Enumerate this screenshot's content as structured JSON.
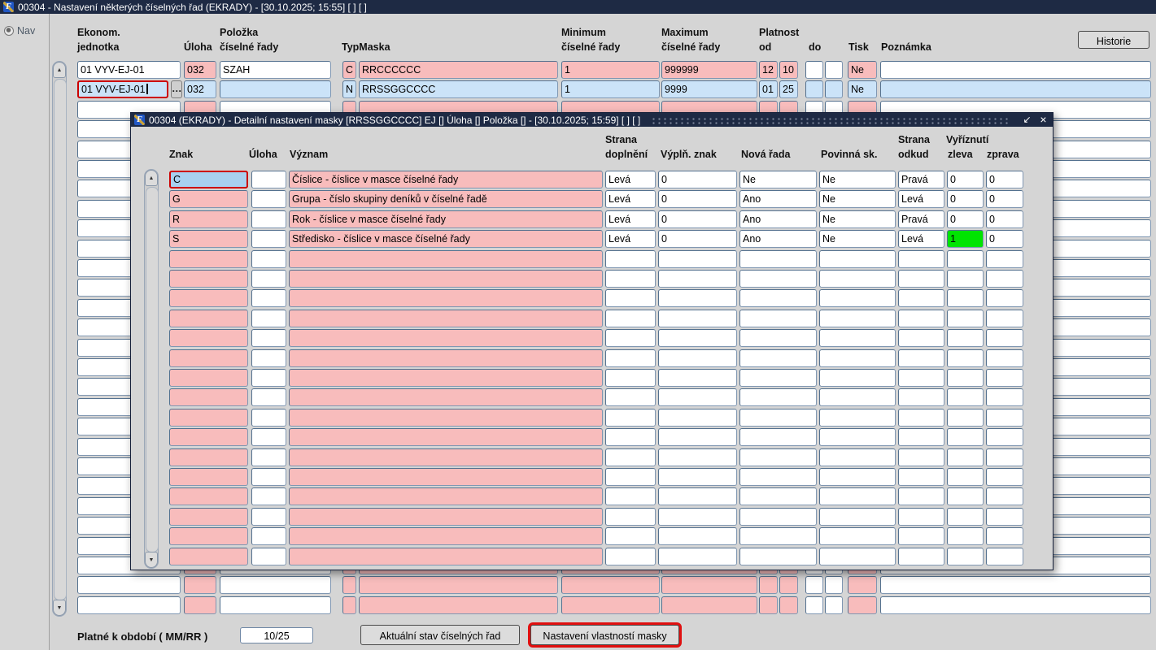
{
  "colors": {
    "titlebar": "#1e2a44",
    "pink": "#f8bcbc",
    "rowblue": "#cbe3f8",
    "selblue": "#a8d0f0",
    "green": "#00e400",
    "focusred": "#cc0000"
  },
  "window": {
    "title": "00304 - Nastavení některých číselných řad (EKRADY) - [30.10.2025; 15:55]  [ ]  [ ]",
    "icon_letter": "F"
  },
  "sidebar": {
    "nav": "Nav"
  },
  "toolbar": {
    "historie": "Historie"
  },
  "main_table": {
    "headers": {
      "ekonom": [
        "Ekonom.",
        "jednotka"
      ],
      "uloha": "Úloha",
      "polozka": [
        "Položka",
        "číselné řady"
      ],
      "typ_maska": "TypMaska",
      "minimum": [
        "Minimum",
        "číselné řady"
      ],
      "maximum": [
        "Maximum",
        "číselné řady"
      ],
      "platnost": [
        "Platnost",
        "od"
      ],
      "do": "do",
      "tisk": "Tisk",
      "poznamka": "Poznámka"
    },
    "rows": [
      {
        "variant": "normal",
        "ekonom": "01 VYV-EJ-01",
        "uloha": "032",
        "polozka": "SZAH",
        "typ": "C",
        "maska": "RRCCCCCC",
        "min": "1",
        "max": "999999",
        "od1": "12",
        "od2": "10",
        "do1": "",
        "do2": "",
        "tisk": "Ne",
        "poznamka": ""
      },
      {
        "variant": "selected",
        "ekonom": "01 VYV-EJ-01",
        "uloha": "032",
        "polozka": "",
        "typ": "N",
        "maska": "RRSSGGCCCC",
        "min": "1",
        "max": "9999",
        "od1": "01",
        "od2": "25",
        "do1": "",
        "do2": "",
        "tisk": "Ne",
        "poznamka": ""
      }
    ],
    "empty_rows": 26
  },
  "footer": {
    "label": "Platné k období ( MM/RR )",
    "value": "10/25",
    "btn_stav": "Aktuální stav číselných řad",
    "btn_maska": "Nastavení vlastností masky"
  },
  "modal": {
    "title": "00304 (EKRADY) - Detailní nastavení masky [RRSSGGCCCC] EJ [] Úloha [] Položka [] - [30.10.2025; 15:59]  [ ]  [ ]",
    "icon_letter": "F",
    "headers": {
      "znak": "Znak",
      "uloha": "Úloha",
      "vyznam": "Význam",
      "strana_doplneni": [
        "Strana",
        "doplnění"
      ],
      "vypln_znak": "Výplň. znak",
      "nova_rada": "Nová řada",
      "povinna_sk": "Povinná sk.",
      "strana_odkud": [
        "Strana",
        "odkud"
      ],
      "vyriznuti": "Vyříznutí",
      "zleva": "zleva",
      "zprava": "zprava"
    },
    "rows": [
      {
        "znak": "C",
        "uloha": "",
        "vyznam": "Číslice - číslice v masce číselné řady",
        "strana_doplneni": "Levá",
        "vypln_znak": "0",
        "nova_rada": "Ne",
        "povinna_sk": "Ne",
        "strana_odkud": "Pravá",
        "zleva": "0",
        "zprava": "0",
        "znak_selected": true
      },
      {
        "znak": "G",
        "uloha": "",
        "vyznam": "Grupa - číslo skupiny deníků v číselné řadě",
        "strana_doplneni": "Levá",
        "vypln_znak": "0",
        "nova_rada": "Ano",
        "povinna_sk": "Ne",
        "strana_odkud": "Levá",
        "zleva": "0",
        "zprava": "0"
      },
      {
        "znak": "R",
        "uloha": "",
        "vyznam": "Rok - číslice v masce číselné řady",
        "strana_doplneni": "Levá",
        "vypln_znak": "0",
        "nova_rada": "Ano",
        "povinna_sk": "Ne",
        "strana_odkud": "Pravá",
        "zleva": "0",
        "zprava": "0"
      },
      {
        "znak": "S",
        "uloha": "",
        "vyznam": "Středisko - číslice v masce číselné řady",
        "strana_doplneni": "Levá",
        "vypln_znak": "0",
        "nova_rada": "Ano",
        "povinna_sk": "Ne",
        "strana_odkud": "Levá",
        "zleva": "1",
        "zprava": "0",
        "green_field": "zleva"
      }
    ],
    "empty_rows": 16
  },
  "icons": {
    "up": "▲",
    "down": "▼",
    "ellipsis": "…",
    "minimize": "↙",
    "close": "×"
  }
}
